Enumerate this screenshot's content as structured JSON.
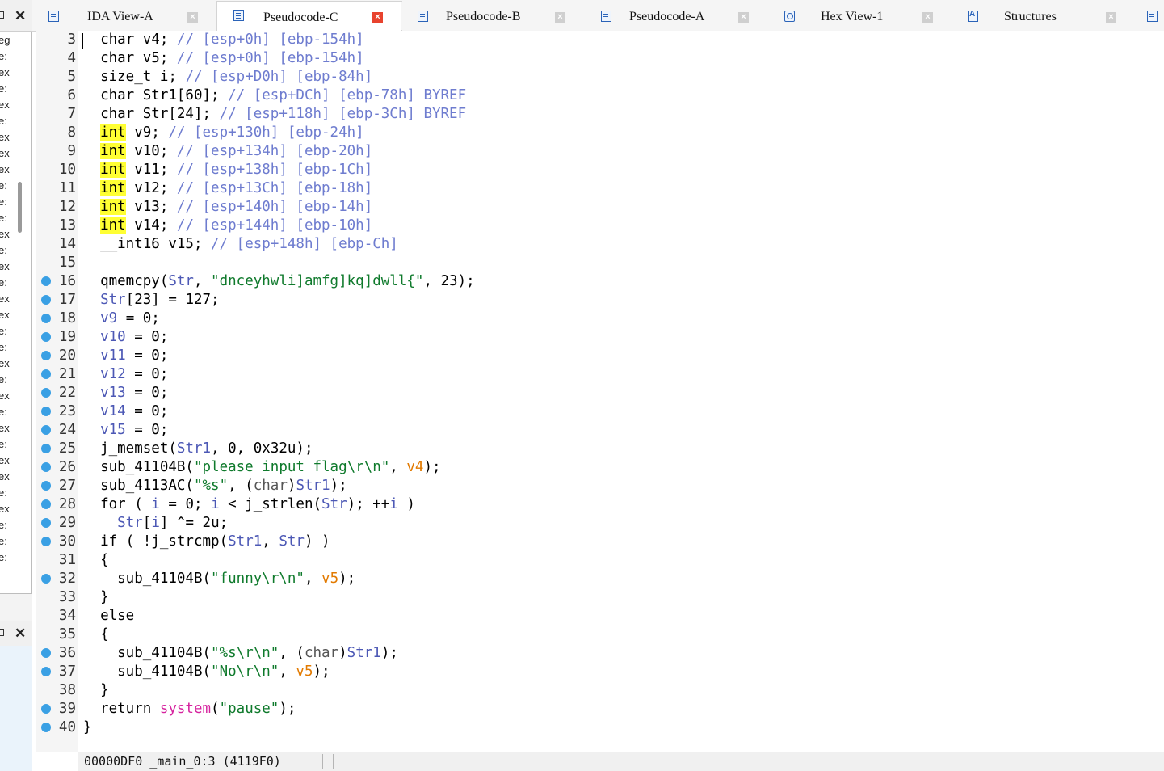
{
  "left_panel": {
    "top_close": "✕",
    "bottom_close": "✕",
    "rows": [
      "eg",
      "e:",
      "ex",
      "e:",
      "ex",
      "e:",
      "ex",
      "ex",
      "ex",
      "e:",
      "e:",
      "e:",
      "ex",
      "e:",
      "ex",
      "e:",
      "ex",
      "ex",
      "e:",
      "e:",
      "ex",
      "e:",
      "ex",
      "e:",
      "ex",
      "e:",
      "ex",
      "ex",
      "e:",
      "ex",
      "e:",
      "e:",
      "e:"
    ]
  },
  "tabs": [
    {
      "label": "IDA View-A",
      "icon": "ida-view-icon",
      "active": false
    },
    {
      "label": "Pseudocode-C",
      "icon": "pseudocode-icon",
      "active": true
    },
    {
      "label": "Pseudocode-B",
      "icon": "pseudocode-icon",
      "active": false
    },
    {
      "label": "Pseudocode-A",
      "icon": "pseudocode-icon",
      "active": false
    },
    {
      "label": "Hex View-1",
      "icon": "hex-view-icon",
      "active": false
    },
    {
      "label": "Structures",
      "icon": "structures-icon",
      "active": false
    }
  ],
  "colors": {
    "variable": "#4c58b5",
    "comment": "#6e7ccf",
    "string": "#0f7a2c",
    "argument": "#e27a00",
    "import": "#d6249f",
    "highlight": "#ffff33",
    "breakpoint": "#3aa0e4"
  },
  "code": [
    {
      "n": "3",
      "bp": false,
      "tokens": [
        [
          "plain",
          "  char v4; "
        ],
        [
          "cmt",
          "// [esp+0h] [ebp-154h]"
        ]
      ]
    },
    {
      "n": "4",
      "bp": false,
      "tokens": [
        [
          "plain",
          "  char v5; "
        ],
        [
          "cmt",
          "// [esp+0h] [ebp-154h]"
        ]
      ]
    },
    {
      "n": "5",
      "bp": false,
      "tokens": [
        [
          "plain",
          "  size_t i; "
        ],
        [
          "cmt",
          "// [esp+D0h] [ebp-84h]"
        ]
      ]
    },
    {
      "n": "6",
      "bp": false,
      "tokens": [
        [
          "plain",
          "  char Str1[60]; "
        ],
        [
          "cmt",
          "// [esp+DCh] [ebp-78h] BYREF"
        ]
      ]
    },
    {
      "n": "7",
      "bp": false,
      "tokens": [
        [
          "plain",
          "  char Str[24]; "
        ],
        [
          "cmt",
          "// [esp+118h] [ebp-3Ch] BYREF"
        ]
      ]
    },
    {
      "n": "8",
      "bp": false,
      "tokens": [
        [
          "plain",
          "  "
        ],
        [
          "hl",
          "int"
        ],
        [
          "plain",
          " v9; "
        ],
        [
          "cmt",
          "// [esp+130h] [ebp-24h]"
        ]
      ]
    },
    {
      "n": "9",
      "bp": false,
      "tokens": [
        [
          "plain",
          "  "
        ],
        [
          "hl",
          "int"
        ],
        [
          "plain",
          " v10; "
        ],
        [
          "cmt",
          "// [esp+134h] [ebp-20h]"
        ]
      ]
    },
    {
      "n": "10",
      "bp": false,
      "tokens": [
        [
          "plain",
          "  "
        ],
        [
          "hl",
          "int"
        ],
        [
          "plain",
          " v11; "
        ],
        [
          "cmt",
          "// [esp+138h] [ebp-1Ch]"
        ]
      ]
    },
    {
      "n": "11",
      "bp": false,
      "tokens": [
        [
          "plain",
          "  "
        ],
        [
          "hl",
          "int"
        ],
        [
          "plain",
          " v12; "
        ],
        [
          "cmt",
          "// [esp+13Ch] [ebp-18h]"
        ]
      ]
    },
    {
      "n": "12",
      "bp": false,
      "tokens": [
        [
          "plain",
          "  "
        ],
        [
          "hl",
          "int"
        ],
        [
          "plain",
          " v13; "
        ],
        [
          "cmt",
          "// [esp+140h] [ebp-14h]"
        ]
      ]
    },
    {
      "n": "13",
      "bp": false,
      "tokens": [
        [
          "plain",
          "  "
        ],
        [
          "hl",
          "int"
        ],
        [
          "plain",
          " v14; "
        ],
        [
          "cmt",
          "// [esp+144h] [ebp-10h]"
        ]
      ]
    },
    {
      "n": "14",
      "bp": false,
      "tokens": [
        [
          "plain",
          "  __int16 v15; "
        ],
        [
          "cmt",
          "// [esp+148h] [ebp-Ch]"
        ]
      ]
    },
    {
      "n": "15",
      "bp": false,
      "tokens": []
    },
    {
      "n": "16",
      "bp": true,
      "tokens": [
        [
          "plain",
          "  qmemcpy("
        ],
        [
          "var",
          "Str"
        ],
        [
          "plain",
          ", "
        ],
        [
          "str",
          "\"dnceyhwli]amfg]kq]dwll{\""
        ],
        [
          "plain",
          ", 23);"
        ]
      ]
    },
    {
      "n": "17",
      "bp": true,
      "tokens": [
        [
          "plain",
          "  "
        ],
        [
          "var",
          "Str"
        ],
        [
          "plain",
          "[23] = 127;"
        ]
      ]
    },
    {
      "n": "18",
      "bp": true,
      "tokens": [
        [
          "plain",
          "  "
        ],
        [
          "var",
          "v9"
        ],
        [
          "plain",
          " = 0;"
        ]
      ]
    },
    {
      "n": "19",
      "bp": true,
      "tokens": [
        [
          "plain",
          "  "
        ],
        [
          "var",
          "v10"
        ],
        [
          "plain",
          " = 0;"
        ]
      ]
    },
    {
      "n": "20",
      "bp": true,
      "tokens": [
        [
          "plain",
          "  "
        ],
        [
          "var",
          "v11"
        ],
        [
          "plain",
          " = 0;"
        ]
      ]
    },
    {
      "n": "21",
      "bp": true,
      "tokens": [
        [
          "plain",
          "  "
        ],
        [
          "var",
          "v12"
        ],
        [
          "plain",
          " = 0;"
        ]
      ]
    },
    {
      "n": "22",
      "bp": true,
      "tokens": [
        [
          "plain",
          "  "
        ],
        [
          "var",
          "v13"
        ],
        [
          "plain",
          " = 0;"
        ]
      ]
    },
    {
      "n": "23",
      "bp": true,
      "tokens": [
        [
          "plain",
          "  "
        ],
        [
          "var",
          "v14"
        ],
        [
          "plain",
          " = 0;"
        ]
      ]
    },
    {
      "n": "24",
      "bp": true,
      "tokens": [
        [
          "plain",
          "  "
        ],
        [
          "var",
          "v15"
        ],
        [
          "plain",
          " = 0;"
        ]
      ]
    },
    {
      "n": "25",
      "bp": true,
      "tokens": [
        [
          "plain",
          "  j_memset("
        ],
        [
          "var",
          "Str1"
        ],
        [
          "plain",
          ", 0, 0x32u);"
        ]
      ]
    },
    {
      "n": "26",
      "bp": true,
      "tokens": [
        [
          "plain",
          "  sub_41104B("
        ],
        [
          "str",
          "\"please input flag\\r\\n\""
        ],
        [
          "plain",
          ", "
        ],
        [
          "arg",
          "v4"
        ],
        [
          "plain",
          ");"
        ]
      ]
    },
    {
      "n": "27",
      "bp": true,
      "tokens": [
        [
          "plain",
          "  sub_4113AC("
        ],
        [
          "str",
          "\"%s\""
        ],
        [
          "plain",
          ", ("
        ],
        [
          "cast",
          "char"
        ],
        [
          "plain",
          ")"
        ],
        [
          "var",
          "Str1"
        ],
        [
          "plain",
          ");"
        ]
      ]
    },
    {
      "n": "28",
      "bp": true,
      "tokens": [
        [
          "plain",
          "  for ( "
        ],
        [
          "var",
          "i"
        ],
        [
          "plain",
          " = 0; "
        ],
        [
          "var",
          "i"
        ],
        [
          "plain",
          " < j_strlen("
        ],
        [
          "var",
          "Str"
        ],
        [
          "plain",
          "); ++"
        ],
        [
          "var",
          "i"
        ],
        [
          "plain",
          " )"
        ]
      ]
    },
    {
      "n": "29",
      "bp": true,
      "tokens": [
        [
          "plain",
          "    "
        ],
        [
          "var",
          "Str"
        ],
        [
          "plain",
          "["
        ],
        [
          "var",
          "i"
        ],
        [
          "plain",
          "] ^= 2u;"
        ]
      ]
    },
    {
      "n": "30",
      "bp": true,
      "tokens": [
        [
          "plain",
          "  if ( !j_strcmp("
        ],
        [
          "var",
          "Str1"
        ],
        [
          "plain",
          ", "
        ],
        [
          "var",
          "Str"
        ],
        [
          "plain",
          ") )"
        ]
      ]
    },
    {
      "n": "31",
      "bp": false,
      "tokens": [
        [
          "plain",
          "  {"
        ]
      ]
    },
    {
      "n": "32",
      "bp": true,
      "tokens": [
        [
          "plain",
          "    sub_41104B("
        ],
        [
          "str",
          "\"funny\\r\\n\""
        ],
        [
          "plain",
          ", "
        ],
        [
          "arg",
          "v5"
        ],
        [
          "plain",
          ");"
        ]
      ]
    },
    {
      "n": "33",
      "bp": false,
      "tokens": [
        [
          "plain",
          "  }"
        ]
      ]
    },
    {
      "n": "34",
      "bp": false,
      "tokens": [
        [
          "plain",
          "  else"
        ]
      ]
    },
    {
      "n": "35",
      "bp": false,
      "tokens": [
        [
          "plain",
          "  {"
        ]
      ]
    },
    {
      "n": "36",
      "bp": true,
      "tokens": [
        [
          "plain",
          "    sub_41104B("
        ],
        [
          "str",
          "\"%s\\r\\n\""
        ],
        [
          "plain",
          ", ("
        ],
        [
          "cast",
          "char"
        ],
        [
          "plain",
          ")"
        ],
        [
          "var",
          "Str1"
        ],
        [
          "plain",
          ");"
        ]
      ]
    },
    {
      "n": "37",
      "bp": true,
      "tokens": [
        [
          "plain",
          "    sub_41104B("
        ],
        [
          "str",
          "\"No\\r\\n\""
        ],
        [
          "plain",
          ", "
        ],
        [
          "arg",
          "v5"
        ],
        [
          "plain",
          ");"
        ]
      ]
    },
    {
      "n": "38",
      "bp": false,
      "tokens": [
        [
          "plain",
          "  }"
        ]
      ]
    },
    {
      "n": "39",
      "bp": true,
      "tokens": [
        [
          "plain",
          "  return "
        ],
        [
          "imp",
          "system"
        ],
        [
          "plain",
          "("
        ],
        [
          "str",
          "\"pause\""
        ],
        [
          "plain",
          ");"
        ]
      ]
    },
    {
      "n": "40",
      "bp": true,
      "tokens": [
        [
          "plain",
          "}"
        ]
      ]
    }
  ],
  "status": {
    "location": "00000DF0 _main_0:3 (4119F0)"
  }
}
